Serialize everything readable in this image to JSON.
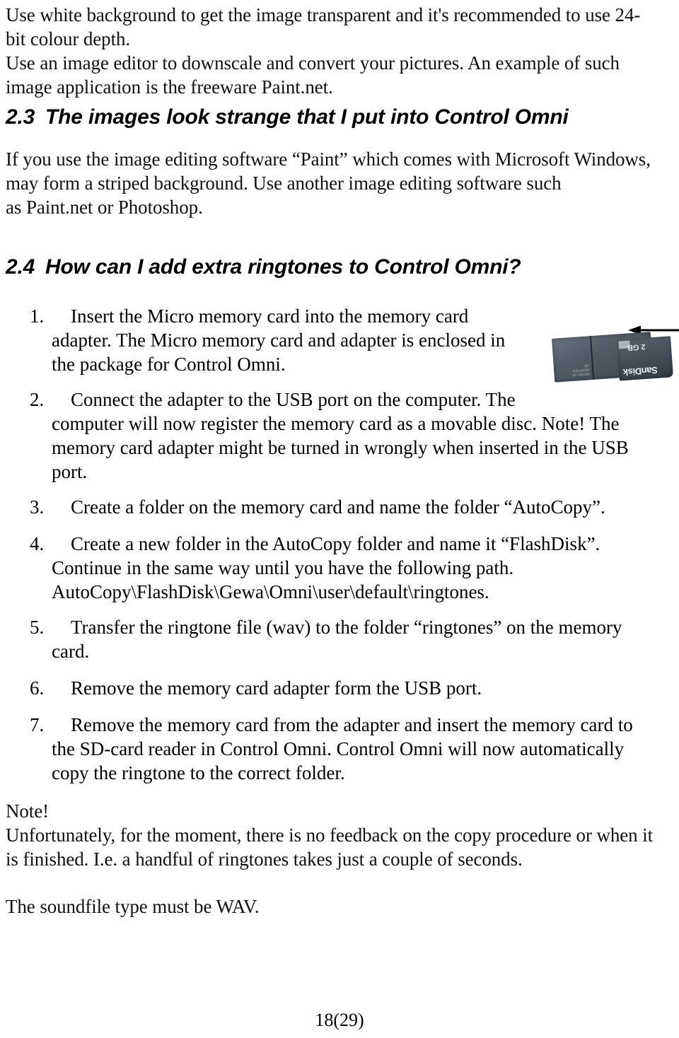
{
  "document": {
    "footer": "18(29)"
  },
  "intro": {
    "lines": [
      "Use white background to get the image transparent and it's recommended to use 24-",
      "bit colour depth.",
      "Use an image editor to downscale and convert your pictures. An example of such",
      "image application is the freeware Paint.net."
    ]
  },
  "section_23": {
    "number": "2.3",
    "title": "The images look strange that I put into Control Omni",
    "body_lines": [
      "If you use the image editing software “Paint” which comes with Microsoft Windows,",
      "may form a striped background. Use another image editing software such",
      "as Paint.net or Photoshop."
    ]
  },
  "section_24": {
    "number": "2.4",
    "title": "How can I add extra ringtones to Control Omni?",
    "steps": [
      {
        "marker": "1.",
        "lines": [
          "Insert the Micro memory card into the memory card",
          "adapter. The Micro memory card and adapter is enclosed in",
          "the package for Control Omni."
        ]
      },
      {
        "marker": "2.",
        "lines": [
          "Connect the adapter to the USB port on the computer. The",
          "computer will now register the memory card as a movable disc. Note! The",
          "memory card adapter might be turned in wrongly when inserted in the USB",
          "port."
        ]
      },
      {
        "marker": "3.",
        "lines": [
          "Create a folder on the memory card and name the folder “AutoCopy”."
        ]
      },
      {
        "marker": "4.",
        "lines": [
          "Create a new folder in the AutoCopy folder and name it “FlashDisk”.",
          "Continue in the same way until you have the following path.",
          "AutoCopy\\FlashDisk\\Gewa\\Omni\\user\\default\\ringtones."
        ]
      },
      {
        "marker": "5.",
        "lines": [
          "Transfer the ringtone file (wav) to the folder “ringtones” on the memory",
          "card."
        ]
      },
      {
        "marker": "6.",
        "lines": [
          "Remove the memory card adapter form the USB port."
        ]
      },
      {
        "marker": "7.",
        "lines": [
          "Remove the memory card from the adapter and insert the memory card to",
          "the SD-card reader in Control Omni. Control Omni will now automatically",
          "copy the ringtone to the correct folder."
        ]
      }
    ]
  },
  "note": {
    "heading": "Note!",
    "lines": [
      "Unfortunately, for the moment, there is no feedback on the copy procedure or when it",
      "is finished. I.e. a handful of ringtones takes just a couple of seconds."
    ]
  },
  "closing": {
    "line": "The soundfile type must be WAV."
  },
  "figure": {
    "brand": "SanDisk",
    "capacity": "2 GB",
    "adapter_print": "MICRO SD\nADAPTER\nCE",
    "arrow_direction": "left"
  }
}
